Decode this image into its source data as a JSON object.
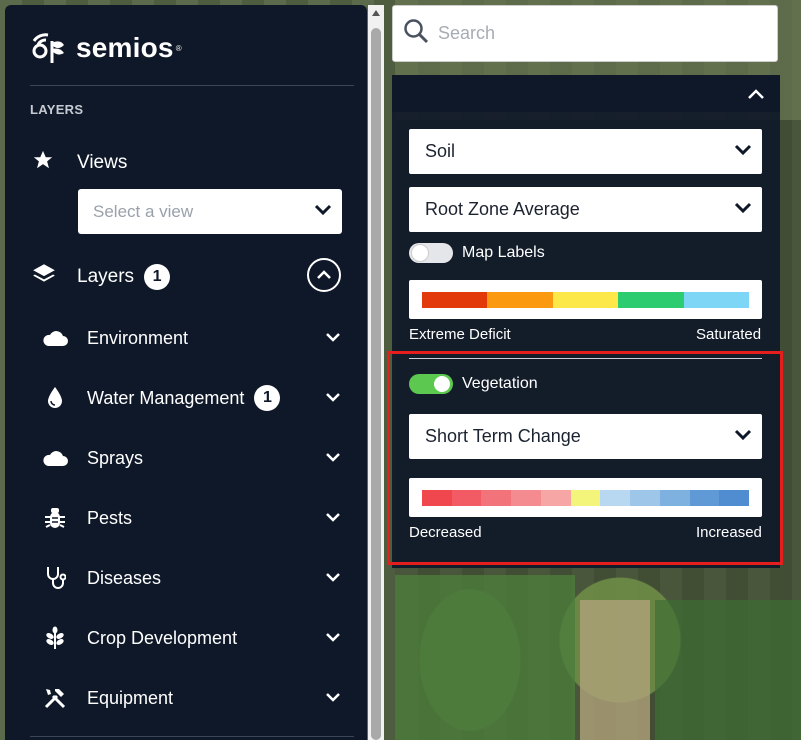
{
  "app": {
    "logo_text": "semios",
    "logo_mark": "®"
  },
  "sidebar": {
    "section_title": "LAYERS",
    "views": {
      "label": "Views",
      "icon": "star-icon",
      "select_placeholder": "Select a view"
    },
    "layers": {
      "label": "Layers",
      "badge": "1",
      "icon": "layers-icon"
    },
    "categories": [
      {
        "label": "Environment",
        "icon": "cloud-icon",
        "badge": null
      },
      {
        "label": "Water Management",
        "icon": "water-drop-icon",
        "badge": "1"
      },
      {
        "label": "Sprays",
        "icon": "cloud-icon",
        "badge": null
      },
      {
        "label": "Pests",
        "icon": "bug-icon",
        "badge": null
      },
      {
        "label": "Diseases",
        "icon": "stethoscope-icon",
        "badge": null
      },
      {
        "label": "Crop Development",
        "icon": "wheat-icon",
        "badge": null
      },
      {
        "label": "Equipment",
        "icon": "tools-icon",
        "badge": null
      }
    ]
  },
  "search": {
    "placeholder": "Search",
    "value": ""
  },
  "panel": {
    "soil_dropdown": "Soil",
    "depth_dropdown": "Root Zone Average",
    "map_labels": {
      "label": "Map Labels",
      "on": false
    },
    "soil_legend": {
      "min_label": "Extreme Deficit",
      "max_label": "Saturated",
      "colors": [
        "#e33a0c",
        "#fb9a10",
        "#fde84a",
        "#2ecc71",
        "#7dd6f5"
      ]
    },
    "vegetation": {
      "label": "Vegetation",
      "on": true
    },
    "vegetation_dropdown": "Short Term Change",
    "vegetation_legend": {
      "min_label": "Decreased",
      "max_label": "Increased",
      "colors": [
        "#f0474f",
        "#f25b63",
        "#f3737a",
        "#f48b90",
        "#f7a6a6",
        "#f3f57a",
        "#b8d7f0",
        "#9ec6e9",
        "#7fb1e0",
        "#5f9ad6",
        "#4f8dd0"
      ]
    }
  },
  "colors": {
    "sidebar_bg": "#0f1828",
    "toggle_on": "#5cc84f",
    "toggle_off": "#e4e6ea",
    "highlight": "#e41d1d"
  }
}
